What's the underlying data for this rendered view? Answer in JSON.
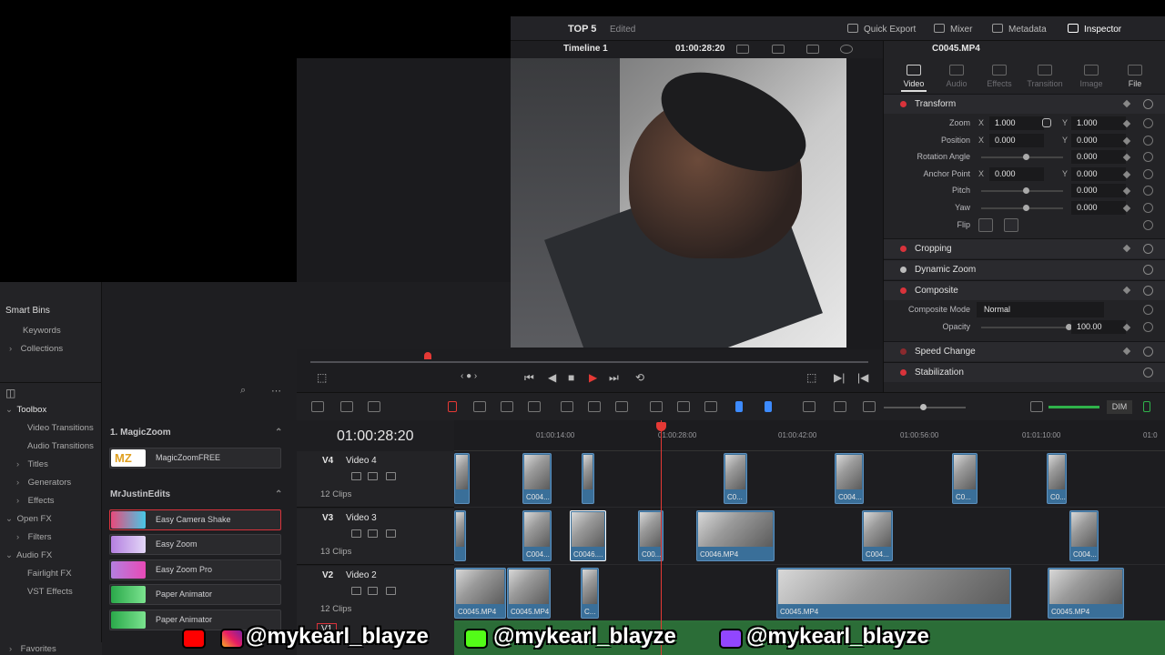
{
  "header": {
    "project": "TOP 5",
    "status": "Edited",
    "buttons": [
      "Quick Export",
      "Mixer",
      "Metadata",
      "Inspector"
    ]
  },
  "viewer": {
    "timeline_name": "Timeline 1",
    "timecode": "01:00:28:20"
  },
  "inspector": {
    "clip_name": "C0045.MP4",
    "tabs": [
      "Video",
      "Audio",
      "Effects",
      "Transition",
      "Image",
      "File"
    ],
    "sections": {
      "transform": "Transform",
      "cropping": "Cropping",
      "dynamic_zoom": "Dynamic Zoom",
      "composite": "Composite",
      "speed_change": "Speed Change",
      "stabilization": "Stabilization"
    },
    "params": {
      "zoom_label": "Zoom",
      "zoom_x": "1.000",
      "zoom_y": "1.000",
      "position_label": "Position",
      "position_x": "0.000",
      "position_y": "0.000",
      "rotation_label": "Rotation Angle",
      "rotation": "0.000",
      "anchor_label": "Anchor Point",
      "anchor_x": "0.000",
      "anchor_y": "0.000",
      "pitch_label": "Pitch",
      "pitch": "0.000",
      "yaw_label": "Yaw",
      "yaw": "0.000",
      "flip_label": "Flip",
      "composite_mode_label": "Composite Mode",
      "composite_mode": "Normal",
      "opacity_label": "Opacity",
      "opacity": "100.00",
      "x": "X",
      "y": "Y"
    }
  },
  "sidebar": {
    "smart_bins": "Smart Bins",
    "keywords": "Keywords",
    "collections": "Collections",
    "toolbox": "Toolbox",
    "items": [
      "Video Transitions",
      "Audio Transitions",
      "Titles",
      "Generators",
      "Effects",
      "Open FX",
      "Filters",
      "Audio FX",
      "Fairlight FX",
      "VST Effects"
    ],
    "favorites": "Favorites"
  },
  "effects_panel": {
    "group1": "1. MagicZoom",
    "magiczoom_item": "MagicZoomFREE",
    "group2": "MrJustinEdits",
    "items": [
      "Easy Camera Shake",
      "Easy Zoom",
      "Easy Zoom Pro",
      "Paper Animator",
      "Paper Animator"
    ]
  },
  "timeline": {
    "timecode": "01:00:28:20",
    "ruler": [
      "01:00:14:00",
      "01:00:28:00",
      "01:00:42:00",
      "01:00:56:00",
      "01:01:10:00",
      "01:0"
    ],
    "dim": "DIM",
    "tracks": [
      {
        "id": "V4",
        "name": "Video 4",
        "count": "12 Clips"
      },
      {
        "id": "V3",
        "name": "Video 3",
        "count": "13 Clips"
      },
      {
        "id": "V2",
        "name": "Video 2",
        "count": "12 Clips"
      },
      {
        "id": "V1"
      }
    ],
    "clips": {
      "v4": [
        "C004...",
        "C0...",
        "C004...",
        "C0...",
        "C0..."
      ],
      "v3": [
        "C004...",
        "C0046....",
        "C00...",
        "C0046.MP4",
        "C004...",
        "C004..."
      ],
      "v2": [
        "C0045.MP4",
        "C0045.MP4",
        "C...",
        "C0045.MP4",
        "C0045.MP4"
      ]
    }
  },
  "overlay": {
    "handle1": "@mykearl_blayze",
    "handle2": "@mykearl_blayze",
    "handle3": "@mykearl_blayze"
  },
  "colors": {
    "accent": "#e53935",
    "clip": "#3a6f99",
    "audio": "#2e7b3c"
  }
}
